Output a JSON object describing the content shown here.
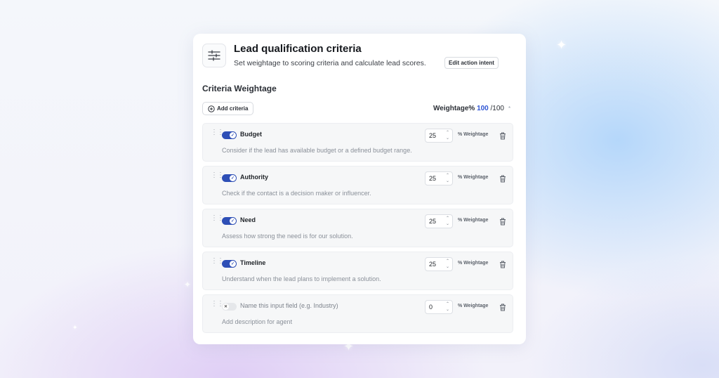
{
  "header": {
    "title": "Lead qualification criteria",
    "subtitle": "Set weightage to scoring criteria and calculate lead scores.",
    "edit_intent_label": "Edit action intent"
  },
  "section": {
    "title": "Criteria Weightage",
    "add_label": "Add criteria",
    "weight_label": "Weightage%",
    "weight_current": "100",
    "weight_max": "/100",
    "required_mark": "*"
  },
  "unit_label": "% Weightage",
  "criteria": [
    {
      "name": "Budget",
      "description": "Consider if the lead has available budget or a defined budget range.",
      "weight": "25",
      "enabled": true
    },
    {
      "name": "Authority",
      "description": "Check if the contact is a decision maker or influencer.",
      "weight": "25",
      "enabled": true
    },
    {
      "name": "Need",
      "description": "Assess how strong the need is for our solution.",
      "weight": "25",
      "enabled": true
    },
    {
      "name": "Timeline",
      "description": "Understand when the lead plans to implement a solution.",
      "weight": "25",
      "enabled": true
    },
    {
      "name": "Name this input field (e.g. Industry)",
      "description": "Add description for agent",
      "weight": "0",
      "enabled": false,
      "is_placeholder": true
    }
  ],
  "colors": {
    "accent": "#2f55d4",
    "toggle_on": "#2e4fb6"
  }
}
